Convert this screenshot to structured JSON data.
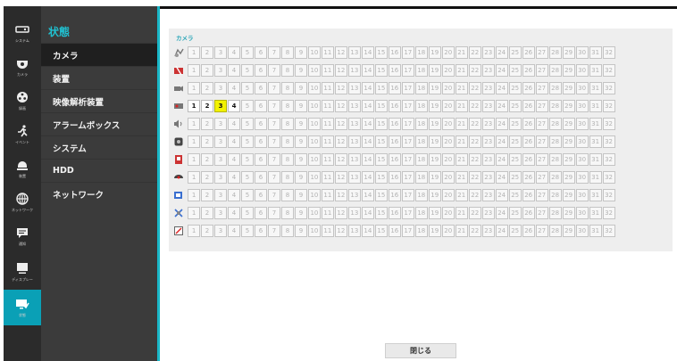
{
  "rail": [
    {
      "icon": "system-icon",
      "label": "システム"
    },
    {
      "icon": "camera-icon",
      "label": "カメラ"
    },
    {
      "icon": "record-icon",
      "label": "録画"
    },
    {
      "icon": "event-icon",
      "label": "イベント"
    },
    {
      "icon": "device-icon",
      "label": "装置"
    },
    {
      "icon": "network-icon",
      "label": "ネットワーク"
    },
    {
      "icon": "notification-icon",
      "label": "通知"
    },
    {
      "icon": "display-icon",
      "label": "ディスプレー"
    },
    {
      "icon": "status-icon",
      "label": "状態"
    }
  ],
  "submenu": {
    "title": "状態",
    "items": [
      "カメラ",
      "装置",
      "映像解析装置",
      "アラームボックス",
      "システム",
      "HDD",
      "ネットワーク"
    ]
  },
  "panel": {
    "title": "カメラ",
    "channels": [
      "1",
      "2",
      "3",
      "4",
      "5",
      "6",
      "7",
      "8",
      "9",
      "10",
      "11",
      "12",
      "13",
      "14",
      "15",
      "16",
      "17",
      "18",
      "19",
      "20",
      "21",
      "22",
      "23",
      "24",
      "25",
      "26",
      "27",
      "28",
      "29",
      "30",
      "31",
      "32"
    ],
    "rows": [
      {
        "icon": "video-loss-icon",
        "active": [],
        "highlight": []
      },
      {
        "icon": "tamper-icon",
        "active": [],
        "highlight": []
      },
      {
        "icon": "camera-connection-icon",
        "active": [],
        "highlight": []
      },
      {
        "icon": "recording-icon",
        "active": [
          1,
          2,
          3,
          4
        ],
        "highlight": [
          3
        ]
      },
      {
        "icon": "audio-icon",
        "active": [],
        "highlight": []
      },
      {
        "icon": "motion-icon",
        "active": [],
        "highlight": []
      },
      {
        "icon": "alarm-in-icon",
        "active": [],
        "highlight": []
      },
      {
        "icon": "ptz-icon",
        "active": [],
        "highlight": []
      },
      {
        "icon": "analytics-icon",
        "active": [],
        "highlight": []
      },
      {
        "icon": "trip-zone-icon",
        "active": [],
        "highlight": []
      },
      {
        "icon": "text-in-icon",
        "active": [],
        "highlight": []
      }
    ]
  },
  "close_label": "閉じる",
  "colors": {
    "accent": "#19b7c8",
    "highlight": "#f2f200",
    "rail_active": "#0aa0b6"
  }
}
